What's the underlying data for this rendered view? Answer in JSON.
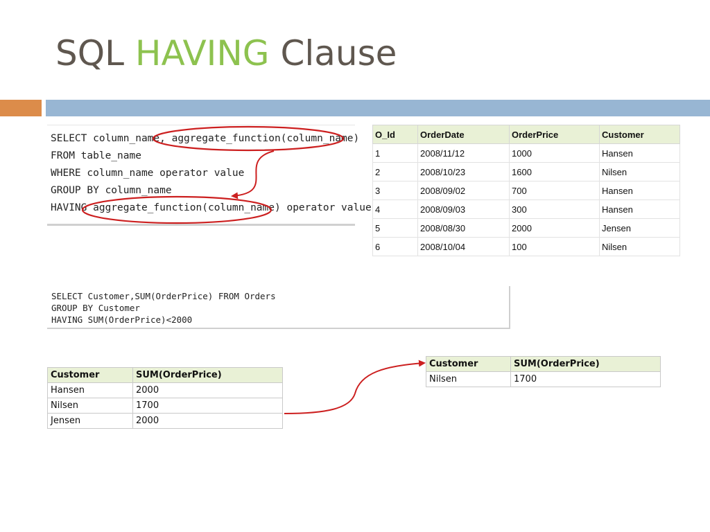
{
  "slide": {
    "title_parts": [
      "SQL ",
      "HAVING",
      " Clause"
    ],
    "accent_colors": {
      "title_text": "#5f574f",
      "title_highlight": "#8dc24f",
      "bar_orange": "#dc8c4a",
      "bar_blue": "#98b6d3",
      "annotation_red": "#cc1f1f",
      "table_header": "#e9f1d6"
    }
  },
  "syntax": {
    "lines": [
      "SELECT column_name, aggregate_function(column_name)",
      "FROM table_name",
      "WHERE column_name operator value",
      "GROUP BY column_name",
      "HAVING aggregate_function(column_name) operator value"
    ]
  },
  "orders_table": {
    "headers": [
      "O_Id",
      "OrderDate",
      "OrderPrice",
      "Customer"
    ],
    "rows": [
      [
        "1",
        "2008/11/12",
        "1000",
        "Hansen"
      ],
      [
        "2",
        "2008/10/23",
        "1600",
        "Nilsen"
      ],
      [
        "3",
        "2008/09/02",
        "700",
        "Hansen"
      ],
      [
        "4",
        "2008/09/03",
        "300",
        "Hansen"
      ],
      [
        "5",
        "2008/08/30",
        "2000",
        "Jensen"
      ],
      [
        "6",
        "2008/10/04",
        "100",
        "Nilsen"
      ]
    ]
  },
  "query": {
    "lines": [
      "SELECT Customer,SUM(OrderPrice) FROM Orders",
      "GROUP BY Customer",
      "HAVING SUM(OrderPrice)<2000"
    ]
  },
  "grouped_table": {
    "headers": [
      "Customer",
      "SUM(OrderPrice)"
    ],
    "rows": [
      [
        "Hansen",
        "2000"
      ],
      [
        "Nilsen",
        "1700"
      ],
      [
        "Jensen",
        "2000"
      ]
    ]
  },
  "result_table": {
    "headers": [
      "Customer",
      "SUM(OrderPrice)"
    ],
    "rows": [
      [
        "Nilsen",
        "1700"
      ]
    ]
  }
}
